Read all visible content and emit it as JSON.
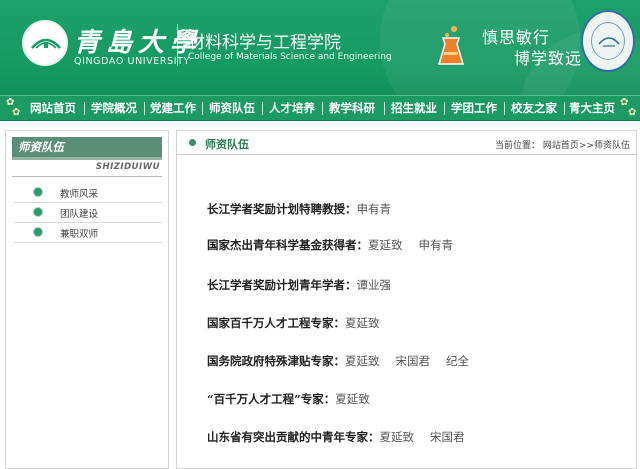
{
  "header": {
    "university_cn": "青島大學",
    "university_en": "QINGDAO UNIVERSITY",
    "college_cn": "材料科学与工程学院",
    "college_en": "College of Materials Science and Engineering",
    "motto_line1": "慎思敏行",
    "motto_line2": "博学致远",
    "brand_color": "#1a9c66"
  },
  "nav": {
    "items": [
      {
        "label": "网站首页"
      },
      {
        "label": "学院概况"
      },
      {
        "label": "党建工作"
      },
      {
        "label": "师资队伍"
      },
      {
        "label": "人才培养"
      },
      {
        "label": "教学科研"
      },
      {
        "label": "招生就业"
      },
      {
        "label": "学团工作"
      },
      {
        "label": "校友之家"
      },
      {
        "label": "青大主页"
      }
    ]
  },
  "sidebar": {
    "title": "师资队伍",
    "pinyin": "SHIZIDUIWU",
    "items": [
      {
        "label": "教师风采",
        "icon": "bullet-icon"
      },
      {
        "label": "团队建设",
        "icon": "bullet-icon"
      },
      {
        "label": "兼职双师",
        "icon": "bullet-icon"
      }
    ]
  },
  "main": {
    "title": "师资队伍",
    "breadcrumb": {
      "prefix": "当前位置：",
      "home": "网站首页",
      "sep": ">>",
      "current": "师资队伍"
    },
    "honors": [
      {
        "category": "长江学者奖励计划特聘教授：",
        "names": [
          "申有青"
        ]
      },
      {
        "category": "国家杰出青年科学基金获得者：",
        "names": [
          "夏延致",
          "申有青"
        ]
      },
      {
        "category": "长江学者奖励计划青年学者：",
        "names": [
          "谭业强"
        ]
      },
      {
        "category": "国家百千万人才工程专家：",
        "names": [
          "夏延致"
        ]
      },
      {
        "category": "国务院政府特殊津贴专家：",
        "names": [
          "夏延致",
          "宋国君",
          "纪全"
        ]
      },
      {
        "category": "“百千万人才工程”专家：",
        "names": [
          "夏延致"
        ]
      },
      {
        "category": "山东省有突出贡献的中青年专家：",
        "names": [
          "夏延致",
          "宋国君"
        ]
      }
    ]
  }
}
